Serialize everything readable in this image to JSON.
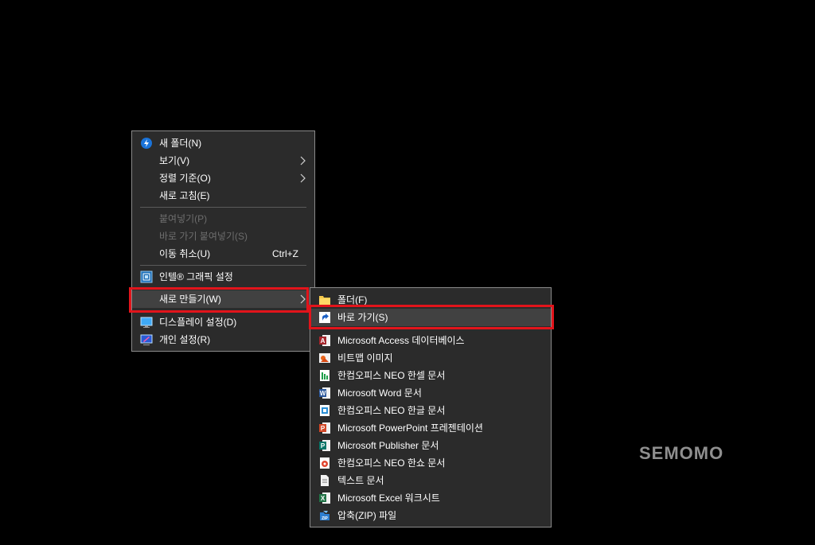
{
  "context_menu": {
    "items": [
      {
        "label": "새 폴더(N)",
        "icon": "new-folder-icon"
      },
      {
        "label": "보기(V)",
        "submenu": true
      },
      {
        "label": "정렬 기준(O)",
        "submenu": true
      },
      {
        "label": "새로 고침(E)"
      },
      {
        "label": "붙여넣기(P)",
        "disabled": true
      },
      {
        "label": "바로 가기 붙여넣기(S)",
        "disabled": true
      },
      {
        "label": "이동 취소(U)",
        "shortcut": "Ctrl+Z"
      },
      {
        "label": "인텔® 그래픽 설정",
        "icon": "intel-graphics-icon"
      },
      {
        "label": "새로 만들기(W)",
        "submenu": true,
        "selected": true
      },
      {
        "label": "디스플레이 설정(D)",
        "icon": "display-settings-icon"
      },
      {
        "label": "개인 설정(R)",
        "icon": "personalize-icon"
      }
    ]
  },
  "new_submenu": {
    "items": [
      {
        "label": "폴더(F)",
        "icon": "folder-icon"
      },
      {
        "label": "바로 가기(S)",
        "icon": "shortcut-icon",
        "selected": true
      },
      {
        "label": "Microsoft Access 데이터베이스",
        "icon": "access-icon"
      },
      {
        "label": "비트맵 이미지",
        "icon": "bitmap-icon"
      },
      {
        "label": "한컴오피스 NEO 한셀 문서",
        "icon": "hancell-icon"
      },
      {
        "label": "Microsoft Word 문서",
        "icon": "word-icon"
      },
      {
        "label": "한컴오피스 NEO 한글 문서",
        "icon": "hwp-icon"
      },
      {
        "label": "Microsoft PowerPoint 프레젠테이션",
        "icon": "powerpoint-icon"
      },
      {
        "label": "Microsoft Publisher 문서",
        "icon": "publisher-icon"
      },
      {
        "label": "한컴오피스 NEO 한쇼 문서",
        "icon": "hanshow-icon"
      },
      {
        "label": "텍스트 문서",
        "icon": "text-document-icon"
      },
      {
        "label": "Microsoft Excel 워크시트",
        "icon": "excel-icon"
      },
      {
        "label": "압축(ZIP) 파일",
        "icon": "zip-icon"
      }
    ]
  },
  "watermark": "SEMOMO",
  "colors": {
    "menu_bg": "#2b2b2b",
    "hover_bg": "#414141",
    "highlight": "#e2141b",
    "text": "#ffffff",
    "disabled_text": "#6d6d6d"
  }
}
